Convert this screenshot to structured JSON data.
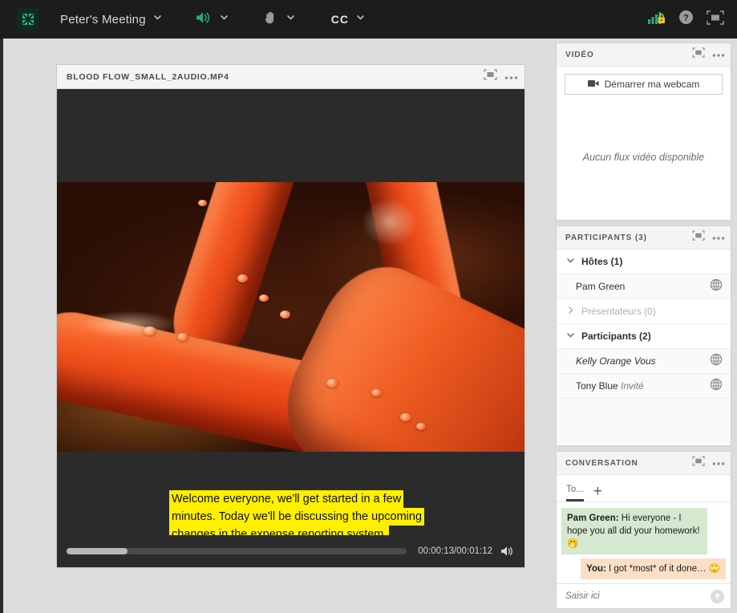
{
  "topbar": {
    "logo_icon": "adobe-connect-logo-icon",
    "meeting_title": "Peter's Meeting",
    "audio_icon": "speaker-on-icon",
    "hand_icon": "raise-hand-icon",
    "cc_label": "CC",
    "status_icon": "connection-strength-secure-icon",
    "help_icon": "help-question-icon",
    "fullscreen_icon": "fullscreen-icon",
    "accent_green": "#21b07a",
    "bar_bg": "#1c1c1c"
  },
  "share_pod": {
    "title": "BLOOD FLOW_SMALL_2AUDIO.MP4",
    "maximize_icon": "maximize-pod-icon",
    "options_icon": "pod-options-icon",
    "captions": [
      "Welcome everyone, we'll get started in a few",
      "minutes. Today we'll be discussing the upcoming",
      "changes in the expense reporting system."
    ],
    "caption_bg": "#ffef00",
    "player": {
      "progress_percent": 18,
      "time_label": "00:00:13/00:01:12",
      "volume_icon": "speaker-on-icon"
    }
  },
  "video_pod": {
    "title": "VIDÉO",
    "maximize_icon": "maximize-pod-icon",
    "options_icon": "pod-options-icon",
    "start_webcam_label": "Démarrer ma webcam",
    "webcam_icon": "video-camera-icon",
    "empty_text": "Aucun flux vidéo disponible"
  },
  "participants_pod": {
    "title": "PARTICIPANTS  (3)",
    "maximize_icon": "maximize-pod-icon",
    "options_icon": "pod-options-icon",
    "groups": [
      {
        "label": "Hôtes (1)",
        "expanded": true,
        "dim": false,
        "members": [
          {
            "name": "Pam Green",
            "role": "",
            "status_icon": "globe-icon",
            "is_me": false
          }
        ]
      },
      {
        "label": "Présentateurs (0)",
        "expanded": false,
        "dim": true,
        "members": []
      },
      {
        "label": "Participants (2)",
        "expanded": true,
        "dim": false,
        "members": [
          {
            "name": "Kelly Orange",
            "role": "Vous",
            "status_icon": "globe-icon",
            "is_me": true
          },
          {
            "name": "Tony Blue",
            "role": "Invité",
            "status_icon": "globe-icon",
            "is_me": false
          }
        ]
      }
    ]
  },
  "chat_pod": {
    "title": "CONVERSATION",
    "maximize_icon": "maximize-pod-icon",
    "options_icon": "pod-options-icon",
    "tab_label": "To...",
    "add_tab_icon": "plus-icon",
    "messages": [
      {
        "sender": "Pam Green:",
        "text": " Hi everyone - I hope you all did your homework! 🤭",
        "side": "other",
        "bg": "#d5e8d0"
      },
      {
        "sender": "You:",
        "text": " I got *most* of it done… 🙄",
        "side": "me",
        "bg": "#fadfc6"
      }
    ],
    "input_placeholder": "Saisir ici",
    "send_icon": "send-arrow-icon"
  }
}
